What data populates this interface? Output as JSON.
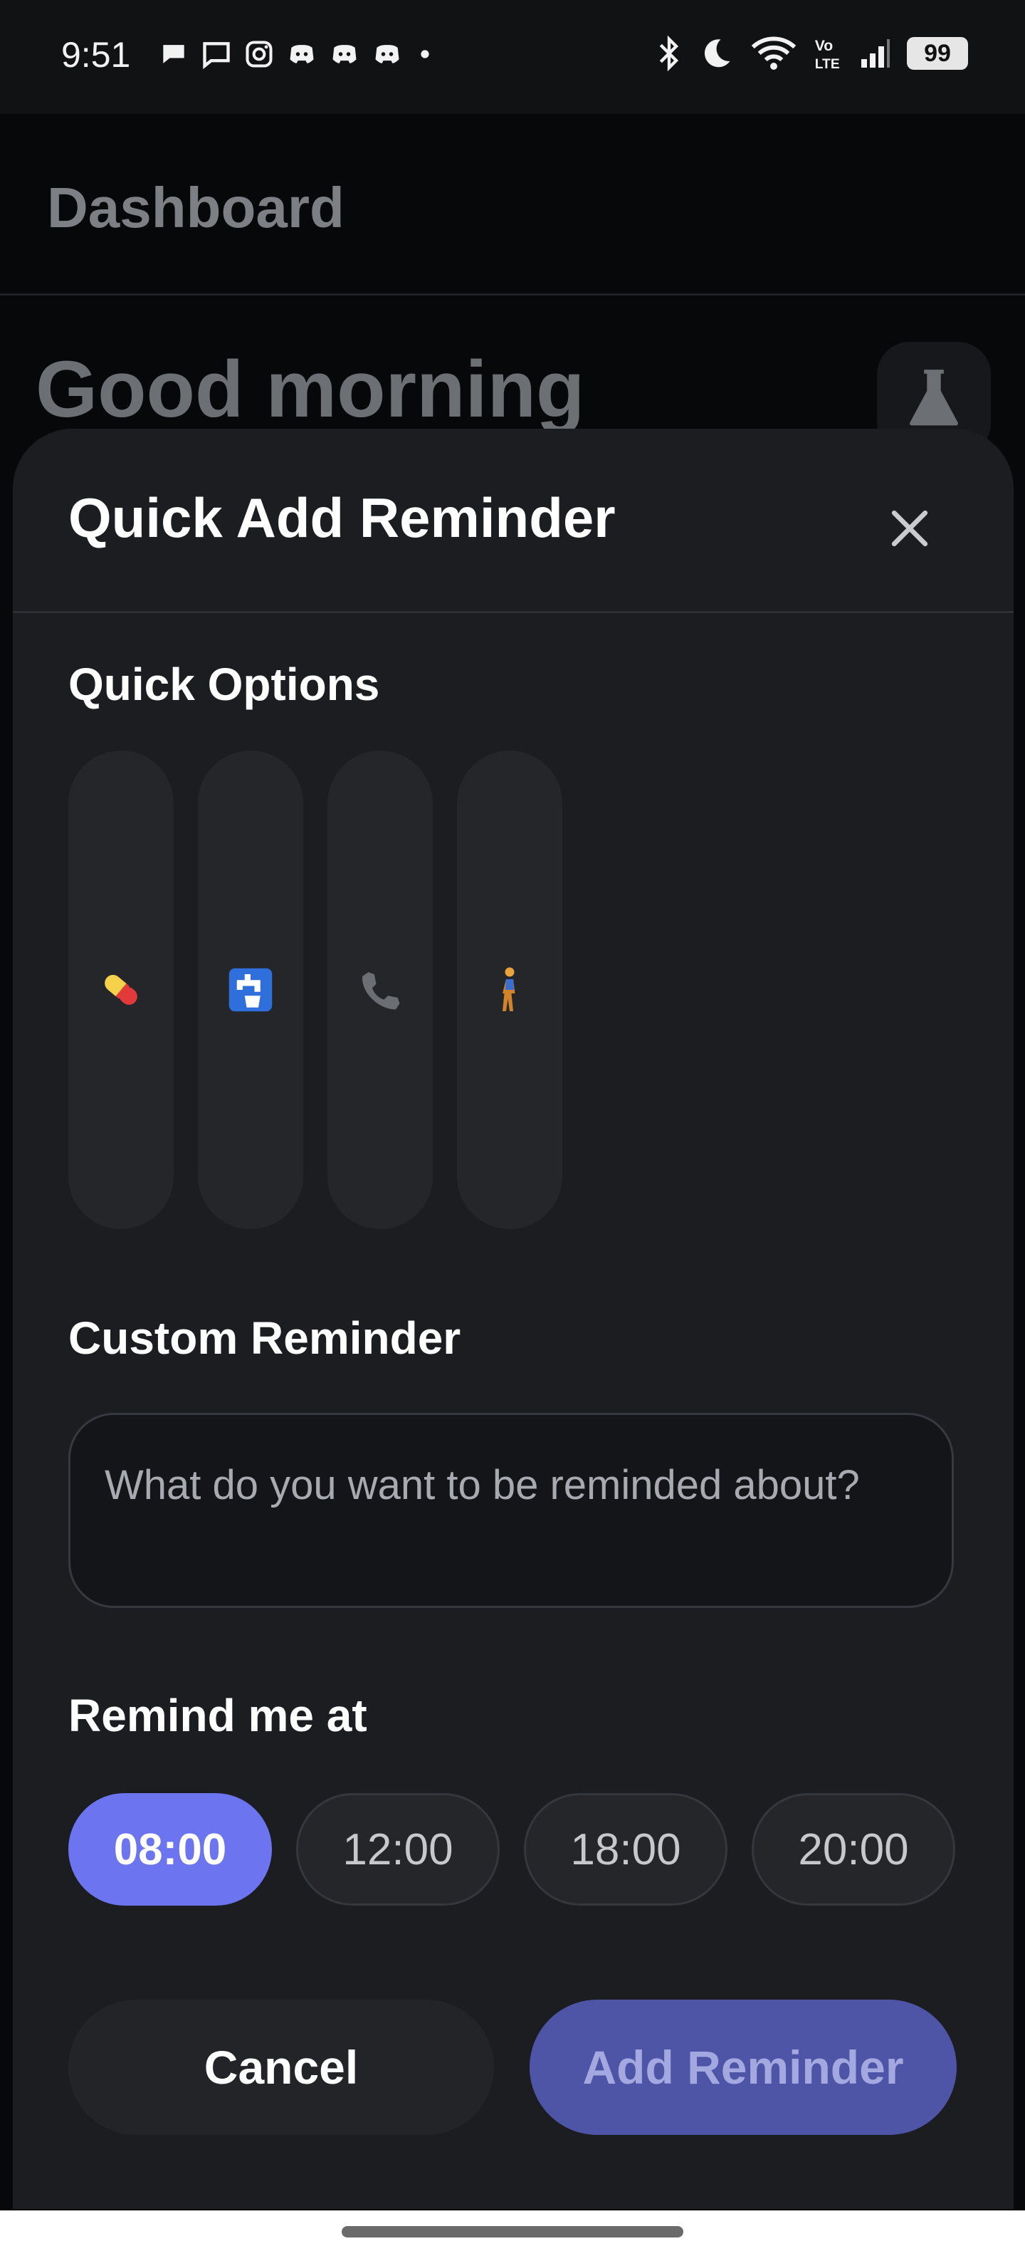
{
  "status_bar": {
    "time": "9:51",
    "battery": "99",
    "left_icons": [
      "chat-bubble-icon",
      "message-icon",
      "instagram-icon",
      "discord-icon",
      "discord-icon",
      "discord-icon",
      "dot-icon"
    ],
    "right_icons": [
      "bluetooth-icon",
      "do-not-disturb-icon",
      "wifi-icon",
      "volte-icon",
      "signal-icon",
      "battery-icon"
    ]
  },
  "background_page": {
    "header_title": "Dashboard",
    "greeting": "Good morning",
    "lab_icon": "flask-icon"
  },
  "sheet": {
    "title": "Quick Add Reminder",
    "close_icon": "close-icon",
    "quick_options_label": "Quick Options",
    "quick_options": [
      {
        "name": "pill",
        "emoji": "💊"
      },
      {
        "name": "water",
        "emoji": "🚰"
      },
      {
        "name": "phone",
        "emoji": "📞"
      },
      {
        "name": "walk",
        "emoji": "🚶"
      }
    ],
    "custom_label": "Custom Reminder",
    "custom_placeholder": "What do you want to be reminded about?",
    "custom_value": "",
    "time_label": "Remind me at",
    "times": [
      "08:00",
      "12:00",
      "18:00",
      "20:00"
    ],
    "selected_time": "08:00",
    "cancel_label": "Cancel",
    "add_label": "Add Reminder"
  },
  "colors": {
    "accent": "#6c74ef",
    "sheet_background": "#1b1d21",
    "add_button_disabled": "#4e54a6"
  }
}
